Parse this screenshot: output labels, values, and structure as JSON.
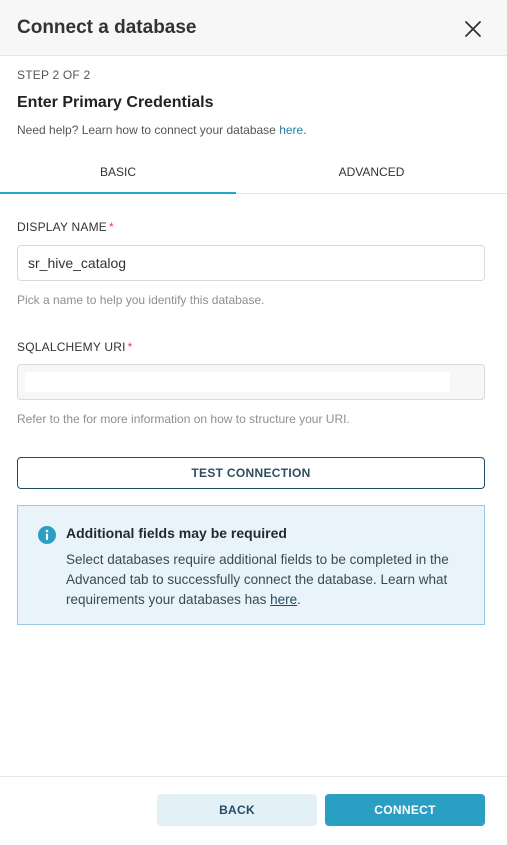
{
  "header": {
    "title": "Connect a database"
  },
  "step": "STEP 2 OF 2",
  "credentials_title": "Enter Primary Credentials",
  "help": {
    "text": "Need help? Learn how to connect your database ",
    "link": "here",
    "suffix": "."
  },
  "tabs": [
    {
      "label": "BASIC",
      "active": true
    },
    {
      "label": "ADVANCED",
      "active": false
    }
  ],
  "display_name": {
    "label": "DISPLAY NAME",
    "required_mark": "*",
    "value": "sr_hive_catalog",
    "hint": "Pick a name to help you identify this database."
  },
  "sqlalchemy_uri": {
    "label": "SQLALCHEMY URI",
    "required_mark": "*",
    "value": "",
    "hint": "Refer to the for more information on how to structure your URI."
  },
  "test_connection_label": "TEST CONNECTION",
  "alert": {
    "icon": "info-icon",
    "title": "Additional fields may be required",
    "body": "Select databases require additional fields to be completed in the Advanced tab to successfully connect the database. Learn what requirements your databases has ",
    "link": "here",
    "suffix": "."
  },
  "footer": {
    "back_label": "BACK",
    "connect_label": "CONNECT"
  },
  "colors": {
    "accent": "#20a7c9",
    "primary_button": "#2b9fc3",
    "required": "#e04355",
    "alert_bg": "#e9f3fa"
  }
}
